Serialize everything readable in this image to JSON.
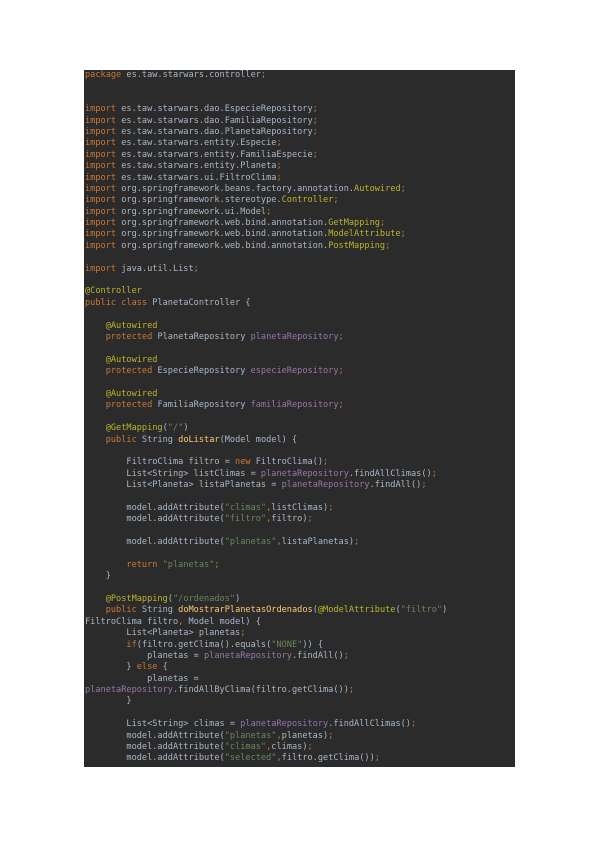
{
  "code_lines": [
    [
      [
        "kw",
        "package"
      ],
      [
        "pl",
        " es.taw.starwars.controller"
      ],
      [
        "kw",
        ";"
      ]
    ],
    [],
    [],
    [
      [
        "kw",
        "import"
      ],
      [
        "pl",
        " es.taw.starwars.dao.EspecieRepository"
      ],
      [
        "kw",
        ";"
      ]
    ],
    [
      [
        "kw",
        "import"
      ],
      [
        "pl",
        " es.taw.starwars.dao.FamiliaRepository"
      ],
      [
        "kw",
        ";"
      ]
    ],
    [
      [
        "kw",
        "import"
      ],
      [
        "pl",
        " es.taw.starwars.dao.PlanetaRepository"
      ],
      [
        "kw",
        ";"
      ]
    ],
    [
      [
        "kw",
        "import"
      ],
      [
        "pl",
        " es.taw.starwars.entity.Especie"
      ],
      [
        "kw",
        ";"
      ]
    ],
    [
      [
        "kw",
        "import"
      ],
      [
        "pl",
        " es.taw.starwars.entity.FamiliaEspecie"
      ],
      [
        "kw",
        ";"
      ]
    ],
    [
      [
        "kw",
        "import"
      ],
      [
        "pl",
        " es.taw.starwars.entity.Planeta"
      ],
      [
        "kw",
        ";"
      ]
    ],
    [
      [
        "kw",
        "import"
      ],
      [
        "pl",
        " es.taw.starwars.ui.FiltroClima"
      ],
      [
        "kw",
        ";"
      ]
    ],
    [
      [
        "kw",
        "import"
      ],
      [
        "pl",
        " org.springframework.beans.factory.annotation."
      ],
      [
        "ann",
        "Autowired"
      ],
      [
        "kw",
        ";"
      ]
    ],
    [
      [
        "kw",
        "import"
      ],
      [
        "pl",
        " org.springframework.stereotype."
      ],
      [
        "ann",
        "Controller"
      ],
      [
        "kw",
        ";"
      ]
    ],
    [
      [
        "kw",
        "import"
      ],
      [
        "pl",
        " org.springframework.ui.Model"
      ],
      [
        "kw",
        ";"
      ]
    ],
    [
      [
        "kw",
        "import"
      ],
      [
        "pl",
        " org.springframework.web.bind.annotation."
      ],
      [
        "ann",
        "GetMapping"
      ],
      [
        "kw",
        ";"
      ]
    ],
    [
      [
        "kw",
        "import"
      ],
      [
        "pl",
        " org.springframework.web.bind.annotation."
      ],
      [
        "ann",
        "ModelAttribute"
      ],
      [
        "kw",
        ";"
      ]
    ],
    [
      [
        "kw",
        "import"
      ],
      [
        "pl",
        " org.springframework.web.bind.annotation."
      ],
      [
        "ann",
        "PostMapping"
      ],
      [
        "kw",
        ";"
      ]
    ],
    [],
    [
      [
        "kw",
        "import"
      ],
      [
        "pl",
        " java.util.List"
      ],
      [
        "kw",
        ";"
      ]
    ],
    [],
    [
      [
        "ann",
        "@Controller"
      ]
    ],
    [
      [
        "kw",
        "public class"
      ],
      [
        "pl",
        " PlanetaController {"
      ]
    ],
    [],
    [
      [
        "ann",
        "    @Autowired"
      ]
    ],
    [
      [
        "kw",
        "    protected"
      ],
      [
        "pl",
        " PlanetaRepository "
      ],
      [
        "fld",
        "planetaRepository"
      ],
      [
        "kw",
        ";"
      ]
    ],
    [],
    [
      [
        "ann",
        "    @Autowired"
      ]
    ],
    [
      [
        "kw",
        "    protected"
      ],
      [
        "pl",
        " EspecieRepository "
      ],
      [
        "fld",
        "especieRepository"
      ],
      [
        "kw",
        ";"
      ]
    ],
    [],
    [
      [
        "ann",
        "    @Autowired"
      ]
    ],
    [
      [
        "kw",
        "    protected"
      ],
      [
        "pl",
        " FamiliaRepository "
      ],
      [
        "fld",
        "familiaRepository"
      ],
      [
        "kw",
        ";"
      ]
    ],
    [],
    [
      [
        "ann",
        "    @GetMapping"
      ],
      [
        "pl",
        "("
      ],
      [
        "str",
        "\"/\""
      ],
      [
        "pl",
        ")"
      ]
    ],
    [
      [
        "kw",
        "    public"
      ],
      [
        "pl",
        " String "
      ],
      [
        "fn",
        "doListar"
      ],
      [
        "pl",
        "(Model model) {"
      ]
    ],
    [],
    [
      [
        "pl",
        "        FiltroClima filtro = "
      ],
      [
        "kw",
        "new"
      ],
      [
        "pl",
        " FiltroClima()"
      ],
      [
        "kw",
        ";"
      ]
    ],
    [
      [
        "pl",
        "        List<String> listClimas = "
      ],
      [
        "fld",
        "planetaRepository"
      ],
      [
        "pl",
        ".findAllClimas()"
      ],
      [
        "kw",
        ";"
      ]
    ],
    [
      [
        "pl",
        "        List<Planeta> listaPlanetas = "
      ],
      [
        "fld",
        "planetaRepository"
      ],
      [
        "pl",
        ".findAll()"
      ],
      [
        "kw",
        ";"
      ]
    ],
    [],
    [
      [
        "pl",
        "        model.addAttribute("
      ],
      [
        "str",
        "\"climas\""
      ],
      [
        "kw",
        ","
      ],
      [
        "pl",
        "listClimas)"
      ],
      [
        "kw",
        ";"
      ]
    ],
    [
      [
        "pl",
        "        model.addAttribute("
      ],
      [
        "str",
        "\"filtro\""
      ],
      [
        "kw",
        ","
      ],
      [
        "pl",
        "filtro)"
      ],
      [
        "kw",
        ";"
      ]
    ],
    [],
    [
      [
        "pl",
        "        model.addAttribute("
      ],
      [
        "str",
        "\"planetas\""
      ],
      [
        "kw",
        ","
      ],
      [
        "pl",
        "listaPlanetas)"
      ],
      [
        "kw",
        ";"
      ]
    ],
    [],
    [
      [
        "kw",
        "        return"
      ],
      [
        "pl",
        " "
      ],
      [
        "str",
        "\"planetas\""
      ],
      [
        "kw",
        ";"
      ]
    ],
    [
      [
        "pl",
        "    }"
      ]
    ],
    [],
    [
      [
        "ann",
        "    @PostMapping"
      ],
      [
        "pl",
        "("
      ],
      [
        "str",
        "\"/ordenados\""
      ],
      [
        "pl",
        ")"
      ]
    ],
    [
      [
        "kw",
        "    public"
      ],
      [
        "pl",
        " String "
      ],
      [
        "fn",
        "doMostrarPlanetasOrdenados"
      ],
      [
        "pl",
        "("
      ],
      [
        "ann",
        "@ModelAttribute"
      ],
      [
        "pl",
        "("
      ],
      [
        "str",
        "\"filtro\""
      ],
      [
        "pl",
        ")"
      ]
    ],
    [
      [
        "pl",
        "FiltroClima filtro"
      ],
      [
        "kw",
        ","
      ],
      [
        "pl",
        " Model model) {"
      ]
    ],
    [
      [
        "pl",
        "        List<Planeta> planetas"
      ],
      [
        "kw",
        ";"
      ]
    ],
    [
      [
        "kw",
        "        if"
      ],
      [
        "pl",
        "(filtro.getClima().equals("
      ],
      [
        "str",
        "\"NONE\""
      ],
      [
        "pl",
        ")) {"
      ]
    ],
    [
      [
        "pl",
        "            planetas = "
      ],
      [
        "fld",
        "planetaRepository"
      ],
      [
        "pl",
        ".findAll()"
      ],
      [
        "kw",
        ";"
      ]
    ],
    [
      [
        "pl",
        "        } "
      ],
      [
        "kw",
        "else"
      ],
      [
        "pl",
        " {"
      ]
    ],
    [
      [
        "pl",
        "            planetas ="
      ]
    ],
    [
      [
        "fld",
        "planetaRepository"
      ],
      [
        "pl",
        ".findAllByClima(filtro.getClima())"
      ],
      [
        "kw",
        ";"
      ]
    ],
    [
      [
        "pl",
        "        }"
      ]
    ],
    [],
    [
      [
        "pl",
        "        List<String> climas = "
      ],
      [
        "fld",
        "planetaRepository"
      ],
      [
        "pl",
        ".findAllClimas()"
      ],
      [
        "kw",
        ";"
      ]
    ],
    [
      [
        "pl",
        "        model.addAttribute("
      ],
      [
        "str",
        "\"planetas\""
      ],
      [
        "kw",
        ","
      ],
      [
        "pl",
        "planetas)"
      ],
      [
        "kw",
        ";"
      ]
    ],
    [
      [
        "pl",
        "        model.addAttribute("
      ],
      [
        "str",
        "\"climas\""
      ],
      [
        "kw",
        ","
      ],
      [
        "pl",
        "climas)"
      ],
      [
        "kw",
        ";"
      ]
    ],
    [
      [
        "pl",
        "        model.addAttribute("
      ],
      [
        "str",
        "\"selected\""
      ],
      [
        "kw",
        ","
      ],
      [
        "pl",
        "filtro.getClima())"
      ],
      [
        "kw",
        ";"
      ]
    ]
  ]
}
